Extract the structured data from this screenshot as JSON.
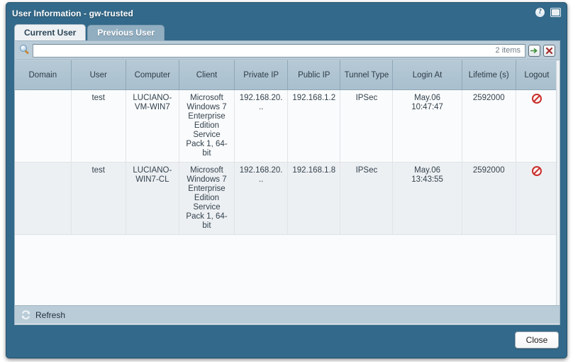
{
  "window": {
    "title": "User Information - gw-trusted",
    "help_icon": "help-icon",
    "restore_icon": "restore-window-icon"
  },
  "tabs": [
    {
      "label": "Current User",
      "active": true
    },
    {
      "label": "Previous User",
      "active": false
    }
  ],
  "toolbar": {
    "search_icon": "search-icon",
    "search_value": "",
    "search_placeholder": "",
    "item_count": "2 items",
    "go_button": "go-arrow-button",
    "clear_button": "clear-button"
  },
  "table": {
    "columns": [
      "Domain",
      "User",
      "Computer",
      "Client",
      "Private IP",
      "Public IP",
      "Tunnel Type",
      "Login At",
      "Lifetime (s)",
      "Logout"
    ],
    "rows": [
      {
        "domain": "",
        "user": "test",
        "computer": "LUCIANO-VM-WIN7",
        "client": "Microsoft Windows 7 Enterprise Edition Service Pack 1, 64-bit",
        "private_ip": "192.168.20...",
        "public_ip": "192.168.1.2",
        "tunnel_type": "IPSec",
        "login_at": "May.06 10:47:47",
        "lifetime": "2592000",
        "logout": "logout-icon"
      },
      {
        "domain": "",
        "user": "test",
        "computer": "LUCIANO-WIN7-CL",
        "client": "Microsoft Windows 7 Enterprise Edition Service Pack 1, 64-bit",
        "private_ip": "192.168.20...",
        "public_ip": "192.168.1.8",
        "tunnel_type": "IPSec",
        "login_at": "May.06 13:43:55",
        "lifetime": "2592000",
        "logout": "logout-icon"
      }
    ]
  },
  "footer_bar": {
    "refresh_label": "Refresh",
    "refresh_icon": "refresh-icon"
  },
  "footer": {
    "close_label": "Close"
  },
  "colors": {
    "window_blue": "#33698a",
    "panel_bg": "#eef1f3",
    "toolbar_bg": "#b9ccd8",
    "header_row": "#aec2d0",
    "row_odd": "#fafbfc",
    "row_even": "#edf0f3",
    "logout_red": "#c9302c",
    "go_green": "#3c8c34",
    "clear_red": "#a52a2a"
  }
}
